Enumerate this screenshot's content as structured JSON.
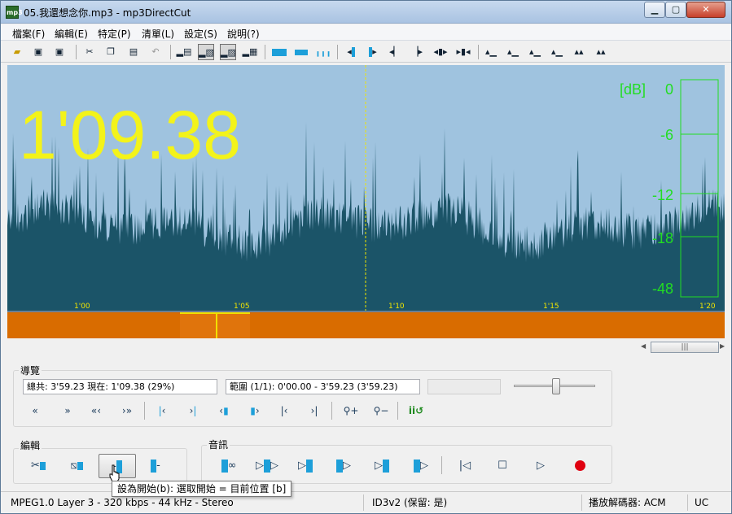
{
  "window": {
    "title": "05.我還想念你.mp3 - mp3DirectCut",
    "app_icon": "mp3",
    "controls": {
      "minimize": "▁",
      "maximize": "▢",
      "close": "✕"
    }
  },
  "menu": [
    "檔案(F)",
    "編輯(E)",
    "特定(P)",
    "清單(L)",
    "設定(S)",
    "說明(?)"
  ],
  "toolbar": {
    "open_icon": "folder-open-icon",
    "save_icon": "save-icon",
    "save_split_icon": "save-list-icon",
    "cut_icon": "scissors-icon",
    "copy_icon": "copy-icon",
    "paste_icon": "paste-icon",
    "undo_icon": "undo-icon"
  },
  "waveform": {
    "time_display": "1'09.38",
    "colors": {
      "background": "#9fc3df",
      "wave": "#1b5468",
      "time": "#f3f31a",
      "meter": "#22dd22"
    },
    "db_unit": "[dB]",
    "db_labels": [
      "0",
      "-6",
      "-12",
      "-18",
      "-48"
    ],
    "time_marks": [
      "1'00",
      "1'05",
      "1'10",
      "1'15",
      "1'20"
    ]
  },
  "navigation": {
    "group_label": "導覽",
    "total_label": "總共: 3'59.23  現在: 1'09.38  (29%)",
    "range_label": "範圍 (1/1): 0'00.00 - 3'59.23 (3'59.23)",
    "volume_level": 0.52
  },
  "edit": {
    "group_label": "編輯"
  },
  "audio": {
    "group_label": "音訊"
  },
  "tooltip": "設為開始(b): 選取開始 = 目前位置  [b]",
  "status": {
    "format": "MPEG1.0 Layer 3 - 320 kbps - 44 kHz - Stereo",
    "tag": "ID3v2 (保留: 是)",
    "decoder": "播放解碼器: ACM",
    "uc": "UC"
  }
}
